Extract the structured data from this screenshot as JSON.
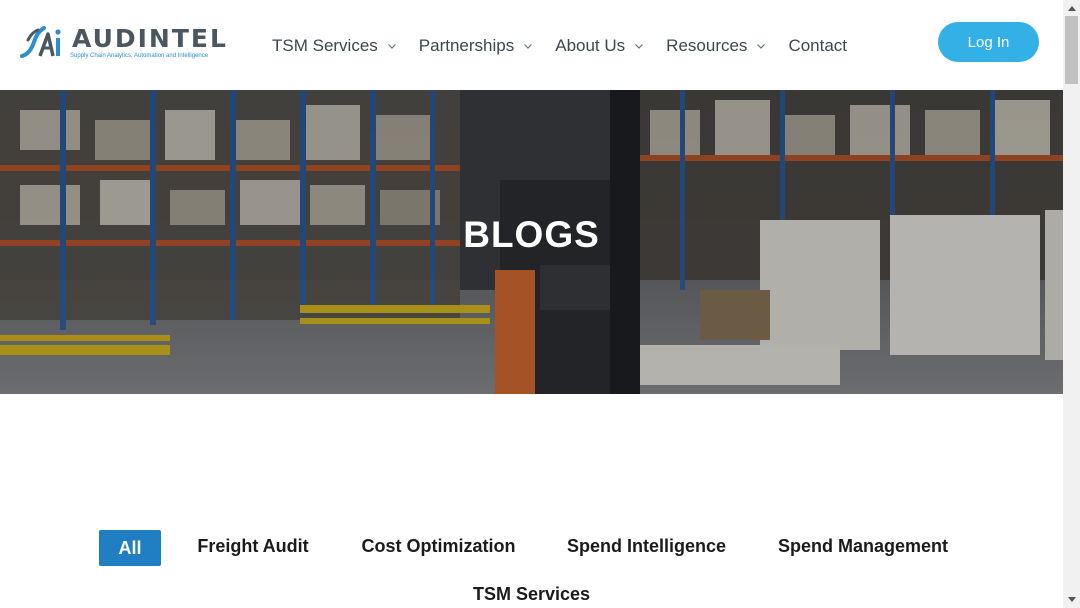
{
  "brand": {
    "name": "AUDINTEL",
    "tagline": "Supply Chain Analytics, Automation and Intelligence",
    "colors": {
      "blue": "#1f7fc2",
      "light_blue": "#33b1e6",
      "grey": "#4a5660"
    }
  },
  "nav": {
    "items": [
      {
        "label": "TSM Services",
        "has_dropdown": true
      },
      {
        "label": "Partnerships",
        "has_dropdown": true
      },
      {
        "label": "About Us",
        "has_dropdown": true
      },
      {
        "label": "Resources",
        "has_dropdown": true
      },
      {
        "label": "Contact",
        "has_dropdown": false
      }
    ],
    "login_label": "Log In"
  },
  "hero": {
    "title": "BLOGS",
    "background": "warehouse-photo"
  },
  "filters": {
    "active": "All",
    "items": [
      "All",
      "Freight Audit",
      "Cost Optimization",
      "Spend Intelligence",
      "Spend Management",
      "TSM Services"
    ]
  },
  "icons": {
    "dropdown": "chevron-down-icon",
    "scroll_up": "arrow-up-icon",
    "scroll_down": "arrow-down-icon"
  }
}
